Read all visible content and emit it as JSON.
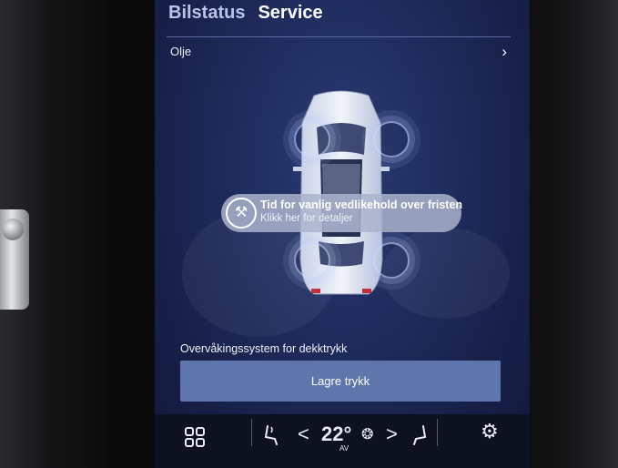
{
  "header": {
    "tabs": [
      {
        "label": "Bilstatus"
      },
      {
        "label": "Service"
      }
    ]
  },
  "oil_row": {
    "label": "Olje",
    "chevron": "›"
  },
  "notification": {
    "icon": "wrench-icon",
    "title": "Tid for vanlig vedlikehold over fristen",
    "subtitle": "Klikk her for detaljer"
  },
  "tpms": {
    "label": "Overvåkingssystem for dekktrykk",
    "button_label": "Lagre trykk"
  },
  "climate_bar": {
    "home_icon": "home-grid-icon",
    "seat_heat_left_icon": "seat-heat-left-icon",
    "temp_down": "<",
    "temperature": "22°",
    "fan_mode": "AV",
    "temp_up": ">",
    "seat_heat_right_icon": "seat-heat-right-icon",
    "settings_icon": "gear-icon"
  },
  "colors": {
    "screen_bg": "#1e2a5a",
    "button_bg": "#5f76ad",
    "toast_bg": "#aab4cd",
    "text": "#ffffff"
  }
}
